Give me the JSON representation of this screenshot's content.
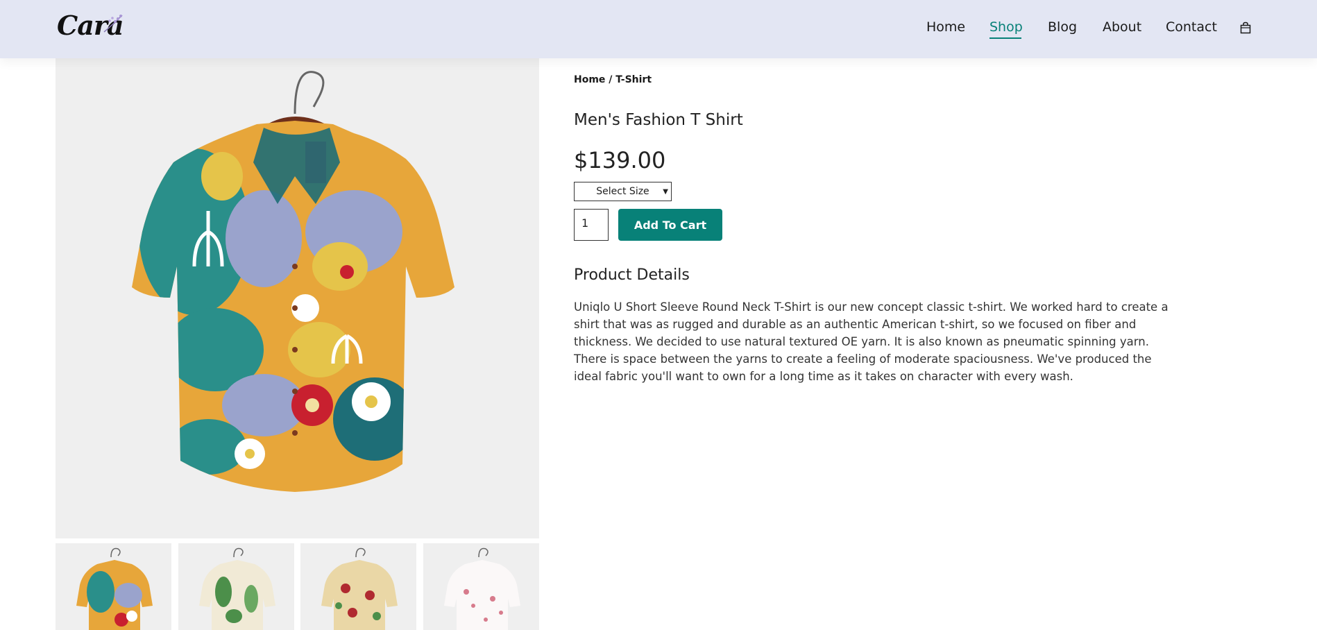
{
  "header": {
    "logo_text": "Cara",
    "nav": [
      {
        "label": "Home"
      },
      {
        "label": "Shop",
        "active": true
      },
      {
        "label": "Blog"
      },
      {
        "label": "About"
      },
      {
        "label": "Contact"
      }
    ],
    "cart_icon": "shopping-bag-icon"
  },
  "colors": {
    "header_bg": "#e3e6f3",
    "accent": "#088178",
    "image_bg": "#efefef"
  },
  "product": {
    "breadcrumb": "Home / T-Shirt",
    "title": "Men's Fashion T Shirt",
    "price": "$139.00",
    "size_select": {
      "selected": "Select Size"
    },
    "quantity": "1",
    "add_to_cart_label": "Add To Cart",
    "details_heading": "Product Details",
    "description": "Uniqlo U Short Sleeve Round Neck T-Shirt is our new concept classic t-shirt. We worked hard to create a shirt that was as rugged and durable as an authentic American t-shirt, so we focused on fiber and thickness. We decided to use natural textured OE yarn. It is also known as pneumatic spinning yarn. There is space between the yarns to create a feeling of moderate spaciousness. We've produced the ideal fabric you'll want to own for a long time as it takes on character with every wash."
  },
  "gallery": {
    "main_image": "floral-shirt-image",
    "thumbnails": [
      "floral-shirt-thumbnail",
      "green-leaf-shirt-thumbnail",
      "red-floral-shirt-thumbnail",
      "pink-floral-shirt-thumbnail"
    ]
  }
}
